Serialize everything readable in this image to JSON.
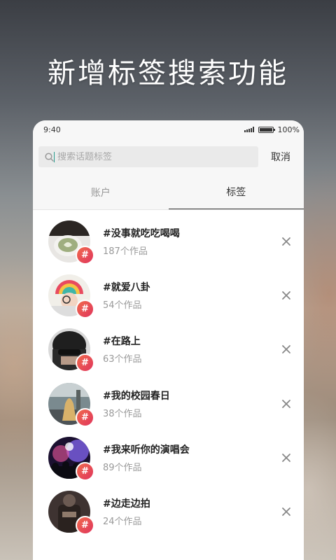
{
  "headline": "新增标签搜索功能",
  "status_bar": {
    "time": "9:40",
    "battery": "100%"
  },
  "search": {
    "placeholder": "搜索话题标签",
    "value": "",
    "cancel_label": "取消"
  },
  "tabs": [
    {
      "label": "账户",
      "active": false
    },
    {
      "label": "标签",
      "active": true
    }
  ],
  "tag_badge_symbol": "#",
  "results": [
    {
      "title": "#没事就吃吃喝喝",
      "count": "187个作品"
    },
    {
      "title": "#就爱八卦",
      "count": "54个作品"
    },
    {
      "title": "#在路上",
      "count": "63个作品"
    },
    {
      "title": "#我的校园春日",
      "count": "38个作品"
    },
    {
      "title": "#我来听你的演唱会",
      "count": "89个作品"
    },
    {
      "title": "#边走边拍",
      "count": "24个作品"
    }
  ],
  "colors": {
    "badge_start": "#f06a4d",
    "badge_end": "#e0355c",
    "caret": "#2a9d8f"
  }
}
